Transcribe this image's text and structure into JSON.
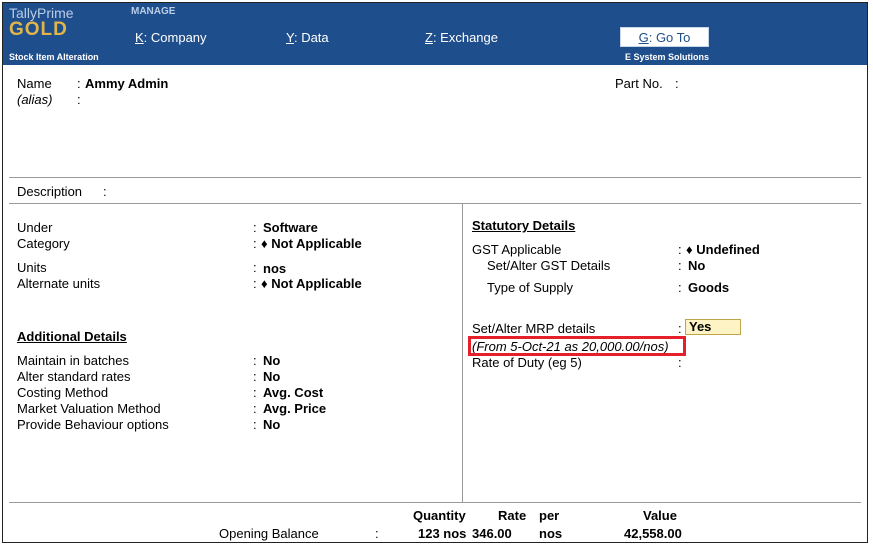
{
  "app": {
    "brand_top": "TallyPrime",
    "brand_bottom": "GOLD",
    "manage_label": "MANAGE"
  },
  "menu": {
    "company": {
      "key": "K",
      "label": ": Company"
    },
    "data": {
      "key": "Y",
      "label": ": Data"
    },
    "exchange": {
      "key": "Z",
      "label": ": Exchange"
    },
    "goto": {
      "key": "G",
      "label": ": Go To"
    }
  },
  "subbar": {
    "screen_title": "Stock Item Alteration",
    "company_name": "E System Solutions"
  },
  "item": {
    "name_label": "Name",
    "name_value": "Ammy Admin",
    "alias_label": "(alias)",
    "partno_label": "Part No.",
    "description_label": "Description"
  },
  "left": {
    "under_label": "Under",
    "under_value": "Software",
    "category_label": "Category",
    "category_value": "♦ Not Applicable",
    "units_label": "Units",
    "units_value": "nos",
    "alt_units_label": "Alternate units",
    "alt_units_value": "♦ Not Applicable"
  },
  "additional": {
    "heading": "Additional Details",
    "rows": [
      {
        "label": "Maintain in batches",
        "value": "No"
      },
      {
        "label": "Alter standard rates",
        "value": "No"
      },
      {
        "label": "Costing Method",
        "value": "Avg. Cost"
      },
      {
        "label": "Market Valuation Method",
        "value": "Avg. Price"
      },
      {
        "label": "Provide Behaviour options",
        "value": "No"
      }
    ]
  },
  "statutory": {
    "heading": "Statutory Details",
    "gst_label": "GST Applicable",
    "gst_value": "♦ Undefined",
    "gst_details_label": "Set/Alter GST Details",
    "gst_details_value": "No",
    "supply_label": "Type of Supply",
    "supply_value": "Goods",
    "mrp_label": "Set/Alter MRP details",
    "mrp_value": "Yes",
    "mrp_note": "(From 5-Oct-21 as 20,000.00/nos)",
    "duty_label": "Rate of Duty (eg 5)"
  },
  "footer": {
    "quantity_header": "Quantity",
    "rate_header": "Rate",
    "per_header": "per",
    "value_header": "Value",
    "opening_label": "Opening Balance",
    "quantity": "123 nos",
    "rate": "346.00",
    "per": "nos",
    "value": "42,558.00"
  },
  "colors": {
    "header_bg": "#1f4e8c",
    "brand_gold": "#e2b54a",
    "highlight_border": "#e5202a",
    "active_field_bg": "#fdf3c4"
  }
}
